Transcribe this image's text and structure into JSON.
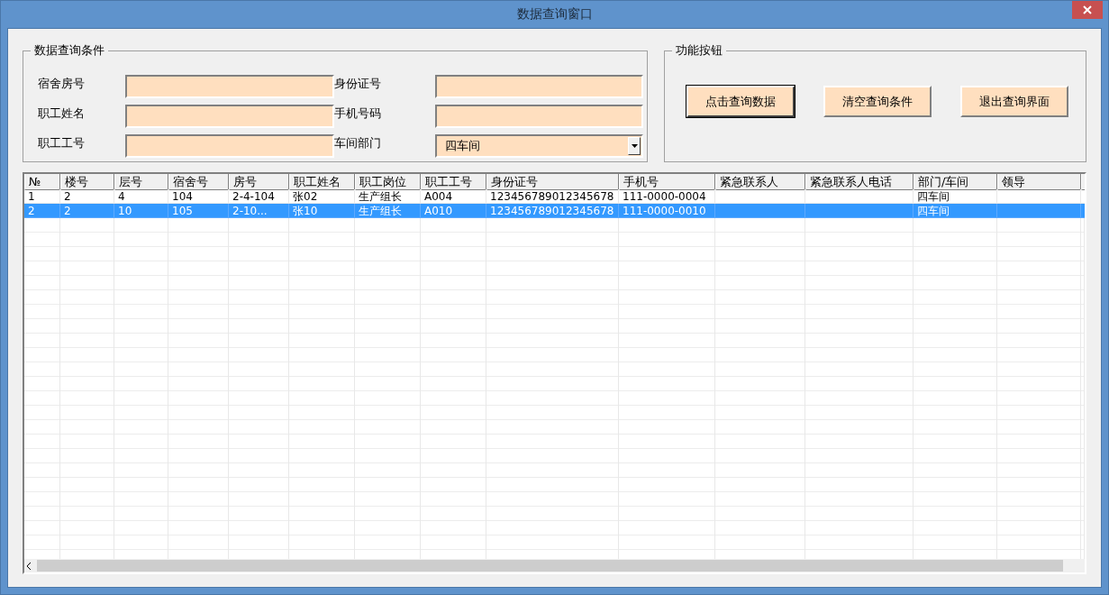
{
  "window": {
    "title": "数据查询窗口"
  },
  "query_group": {
    "title": "数据查询条件",
    "fields": [
      {
        "label": "宿舍房号",
        "kind": "text"
      },
      {
        "label": "身份证号",
        "kind": "text"
      },
      {
        "label": "职工姓名",
        "kind": "text"
      },
      {
        "label": "手机号码",
        "kind": "text"
      },
      {
        "label": "职工工号",
        "kind": "text"
      },
      {
        "label": "车间部门",
        "kind": "combo",
        "value": "四车间"
      }
    ]
  },
  "button_group": {
    "title": "功能按钮",
    "buttons": [
      {
        "label": "点击查询数据",
        "default": true
      },
      {
        "label": "清空查询条件",
        "default": false
      },
      {
        "label": "退出查询界面",
        "default": false
      }
    ]
  },
  "table": {
    "columns": [
      "№",
      "楼号",
      "层号",
      "宿舍号",
      "房号",
      "职工姓名",
      "职工岗位",
      "职工工号",
      "身份证号",
      "手机号",
      "紧急联系人",
      "紧急联系人电话",
      "部门/车间",
      "领导"
    ],
    "rows": [
      {
        "selected": false,
        "cells": [
          "1",
          "2",
          "4",
          "104",
          "2-4-104",
          "张02",
          "生产组长",
          "A004",
          "123456789012345678",
          "111-0000-0004",
          "",
          "",
          "四车间",
          ""
        ]
      },
      {
        "selected": true,
        "cells": [
          "2",
          "2",
          "10",
          "105",
          "2-10...",
          "张10",
          "生产组长",
          "A010",
          "123456789012345678",
          "111-0000-0010",
          "",
          "",
          "四车间",
          ""
        ]
      }
    ]
  }
}
